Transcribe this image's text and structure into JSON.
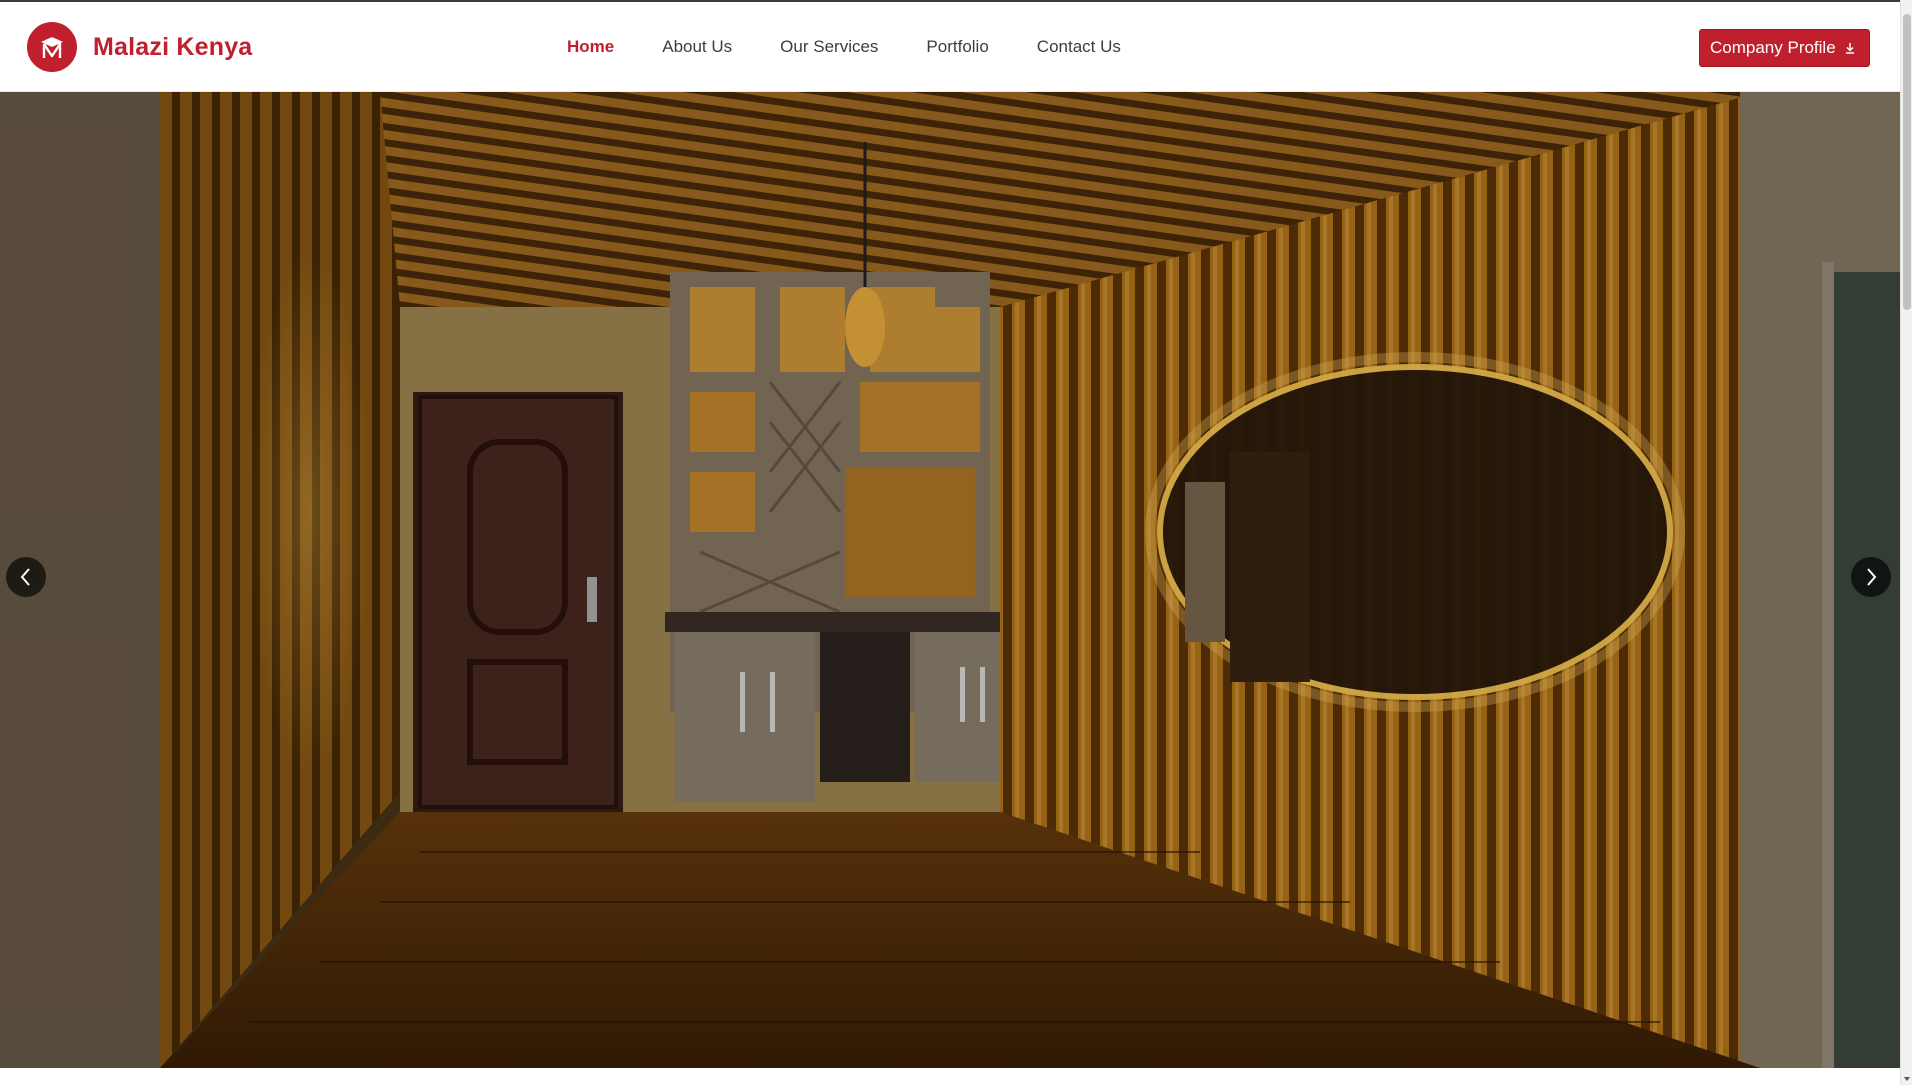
{
  "brand": {
    "name": "Malazi Kenya",
    "logo_letter": "M",
    "color": "#c0202d"
  },
  "nav": {
    "items": [
      {
        "label": "Home",
        "active": true
      },
      {
        "label": "About Us",
        "active": false
      },
      {
        "label": "Our Services",
        "active": false
      },
      {
        "label": "Portfolio",
        "active": false
      },
      {
        "label": "Contact Us",
        "active": false
      }
    ]
  },
  "cta": {
    "label": "Company Profile",
    "icon": "download-icon"
  },
  "hero": {
    "image": "interior-wood-slat-room",
    "prev_icon": "chevron-left-icon",
    "next_icon": "chevron-right-icon"
  },
  "colors": {
    "accent": "#c0202d",
    "nav_text": "#3d3d3d"
  }
}
